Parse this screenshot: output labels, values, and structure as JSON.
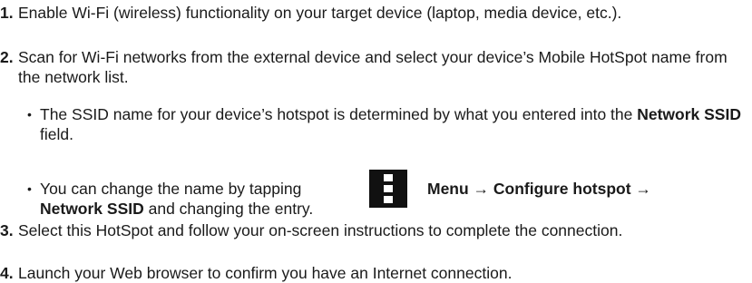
{
  "steps": [
    {
      "num": "1.",
      "text": "Enable Wi-Fi (wireless) functionality on your target device (laptop, media device, etc.)."
    },
    {
      "num": "2.",
      "text": "Scan for Wi-Fi networks from the external device and select your device’s Mobile HotSpot name from the network list."
    },
    {
      "num": "3.",
      "text": "Select this HotSpot and follow your on-screen instructions to complete the connection."
    },
    {
      "num": "4.",
      "text": "Launch your Web browser to confirm you have an Internet connection."
    }
  ],
  "bullets": [
    {
      "bullet": "•",
      "pre": "The SSID name for your device’s hotspot is determined by what you entered into the ",
      "bold": "Network SSID",
      "post": " field."
    },
    {
      "bullet": "•",
      "pre": "You can change the name by tapping",
      "after_icon": "Menu → Configure hotspot →",
      "line2_bold": "Network SSID",
      "line2_post": " and changing the entry."
    }
  ],
  "icons": {
    "menu": "menu-icon"
  }
}
